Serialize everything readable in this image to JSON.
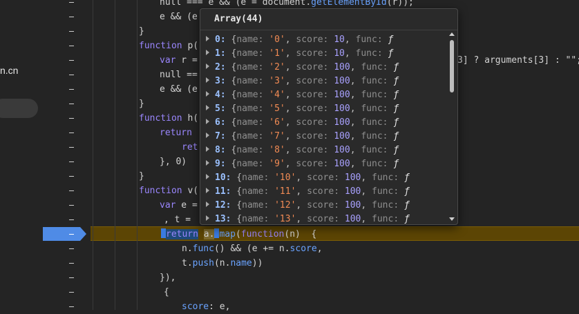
{
  "sidebar": {
    "partial_text": "n.cn"
  },
  "code": {
    "lines": [
      {
        "segments": [
          {
            "t": "null === e && (e = document.",
            "c": ""
          },
          {
            "t": "getElementById",
            "c": "prop"
          },
          {
            "t": "(r));",
            "c": ""
          }
        ]
      },
      {
        "segments": [
          {
            "t": "e && (e",
            "c": ""
          }
        ]
      },
      {
        "segments": [
          {
            "t": "}",
            "c": ""
          }
        ]
      },
      {
        "segments": [
          {
            "t": "function",
            "c": "kw"
          },
          {
            "t": " p(",
            "c": ""
          }
        ]
      },
      {
        "segments": [
          {
            "t": "var",
            "c": "kw"
          },
          {
            "t": " r =",
            "c": ""
          }
        ]
      },
      {
        "segments": [
          {
            "t": "null ==",
            "c": ""
          }
        ]
      },
      {
        "segments": [
          {
            "t": "e && (e",
            "c": ""
          }
        ]
      },
      {
        "segments": [
          {
            "t": "}",
            "c": ""
          }
        ]
      },
      {
        "segments": [
          {
            "t": "function",
            "c": "kw"
          },
          {
            "t": " h(",
            "c": ""
          }
        ]
      },
      {
        "segments": [
          {
            "t": "return",
            "c": "kw"
          }
        ]
      },
      {
        "segments": [
          {
            "t": "ret",
            "c": "kw"
          }
        ]
      },
      {
        "segments": [
          {
            "t": "}, 0)",
            "c": ""
          }
        ]
      },
      {
        "segments": [
          {
            "t": "}",
            "c": ""
          }
        ]
      },
      {
        "segments": [
          {
            "t": "function",
            "c": "kw"
          },
          {
            "t": " v(",
            "c": ""
          }
        ]
      },
      {
        "segments": [
          {
            "t": "var",
            "c": "kw"
          },
          {
            "t": " e =",
            "c": ""
          }
        ]
      },
      {
        "segments": [
          {
            "t": ", t =",
            "c": ""
          }
        ]
      },
      {
        "segments": []
      },
      {
        "segments": [
          {
            "t": "n.",
            "c": ""
          },
          {
            "t": "func",
            "c": "prop"
          },
          {
            "t": "() && (e += n.",
            "c": ""
          },
          {
            "t": "score",
            "c": "prop"
          },
          {
            "t": ",",
            "c": ""
          }
        ]
      },
      {
        "segments": [
          {
            "t": "t.",
            "c": ""
          },
          {
            "t": "push",
            "c": "prop"
          },
          {
            "t": "(n.",
            "c": ""
          },
          {
            "t": "name",
            "c": "prop"
          },
          {
            "t": "))",
            "c": ""
          }
        ]
      },
      {
        "segments": [
          {
            "t": "}),",
            "c": ""
          }
        ]
      },
      {
        "segments": [
          {
            "t": "{",
            "c": ""
          }
        ]
      },
      {
        "segments": [
          {
            "t": "score",
            "c": "prop"
          },
          {
            "t": ": e,",
            "c": ""
          }
        ]
      }
    ],
    "right_fragment": "3] ? arguments[3] : \"\";",
    "exec_line": {
      "return_kw": "return",
      "target": "a.",
      "method": "map",
      "open": "(",
      "fn_kw": "function",
      "args": "(n)  {"
    }
  },
  "popover": {
    "title": "Array(44)",
    "rows": [
      {
        "index": "0:",
        "name": "'0'",
        "score": "10"
      },
      {
        "index": "1:",
        "name": "'1'",
        "score": "10"
      },
      {
        "index": "2:",
        "name": "'2'",
        "score": "100"
      },
      {
        "index": "3:",
        "name": "'3'",
        "score": "100"
      },
      {
        "index": "4:",
        "name": "'4'",
        "score": "100"
      },
      {
        "index": "5:",
        "name": "'5'",
        "score": "100"
      },
      {
        "index": "6:",
        "name": "'6'",
        "score": "100"
      },
      {
        "index": "7:",
        "name": "'7'",
        "score": "100"
      },
      {
        "index": "8:",
        "name": "'8'",
        "score": "100"
      },
      {
        "index": "9:",
        "name": "'9'",
        "score": "100"
      },
      {
        "index": "10:",
        "name": "'10'",
        "score": "100"
      },
      {
        "index": "11:",
        "name": "'11'",
        "score": "100"
      },
      {
        "index": "12:",
        "name": "'12'",
        "score": "100"
      },
      {
        "index": "13:",
        "name": "'13'",
        "score": "100"
      }
    ],
    "labels": {
      "name_key": "name:",
      "score_key": "score:",
      "func_key": "func:",
      "func_glyph": "ƒ"
    }
  },
  "colors": {
    "breakpoint": "#4f8be6",
    "exec_highlight": "#5c4504",
    "keyword": "#9a86fd",
    "string": "#f28b54"
  }
}
